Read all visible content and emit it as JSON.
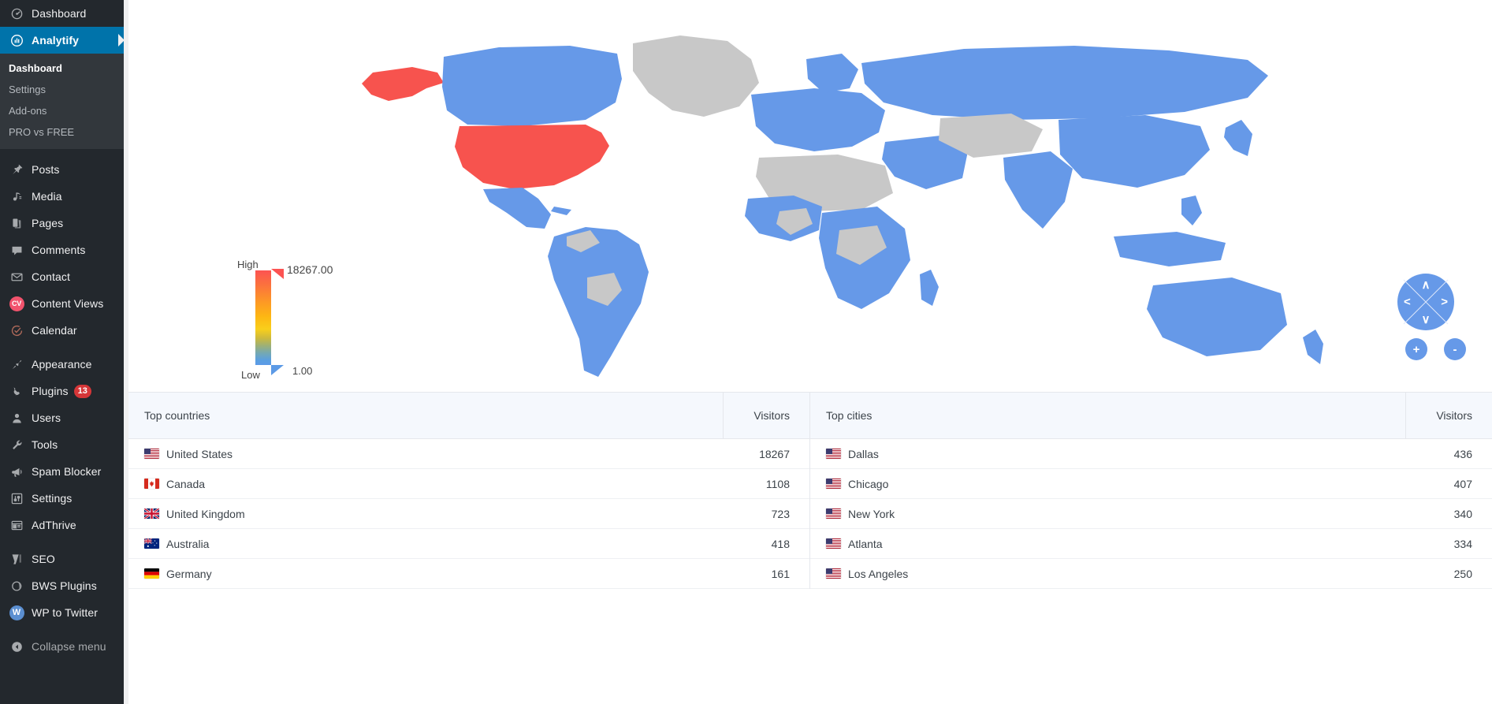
{
  "sidebar": {
    "items": [
      {
        "label": "Dashboard",
        "icon": "dashboard-icon",
        "name": "sidebar-item-dashboard"
      },
      {
        "label": "Analytify",
        "icon": "analytify-icon",
        "name": "sidebar-item-analytify",
        "active": true
      },
      {
        "label": "Posts",
        "icon": "pin-icon",
        "name": "sidebar-item-posts"
      },
      {
        "label": "Media",
        "icon": "media-icon",
        "name": "sidebar-item-media"
      },
      {
        "label": "Pages",
        "icon": "pages-icon",
        "name": "sidebar-item-pages"
      },
      {
        "label": "Comments",
        "icon": "comment-icon",
        "name": "sidebar-item-comments"
      },
      {
        "label": "Contact",
        "icon": "envelope-icon",
        "name": "sidebar-item-contact"
      },
      {
        "label": "Content Views",
        "icon": "cv-icon",
        "name": "sidebar-item-content-views"
      },
      {
        "label": "Calendar",
        "icon": "calendar-icon",
        "name": "sidebar-item-calendar"
      },
      {
        "label": "Appearance",
        "icon": "paintbrush-icon",
        "name": "sidebar-item-appearance"
      },
      {
        "label": "Plugins",
        "icon": "plug-icon",
        "name": "sidebar-item-plugins",
        "badge": "13"
      },
      {
        "label": "Users",
        "icon": "user-icon",
        "name": "sidebar-item-users"
      },
      {
        "label": "Tools",
        "icon": "wrench-icon",
        "name": "sidebar-item-tools"
      },
      {
        "label": "Spam Blocker",
        "icon": "megaphone-icon",
        "name": "sidebar-item-spam-blocker"
      },
      {
        "label": "Settings",
        "icon": "sliders-icon",
        "name": "sidebar-item-settings"
      },
      {
        "label": "AdThrive",
        "icon": "adthrive-icon",
        "name": "sidebar-item-adthrive"
      },
      {
        "label": "SEO",
        "icon": "yoast-icon",
        "name": "sidebar-item-seo"
      },
      {
        "label": "BWS Plugins",
        "icon": "bws-icon",
        "name": "sidebar-item-bws-plugins"
      },
      {
        "label": "WP to Twitter",
        "icon": "wp-twitter-icon",
        "name": "sidebar-item-wp-to-twitter"
      },
      {
        "label": "Collapse menu",
        "icon": "collapse-icon",
        "name": "sidebar-collapse-menu"
      }
    ],
    "submenu": {
      "items": [
        {
          "label": "Dashboard",
          "current": true
        },
        {
          "label": "Settings",
          "current": false
        },
        {
          "label": "Add-ons",
          "current": false
        },
        {
          "label": "PRO vs FREE",
          "current": false
        }
      ]
    }
  },
  "map": {
    "legend": {
      "high_label": "High",
      "low_label": "Low",
      "high_value": "18267.00",
      "low_value": "1.00",
      "high_color": "#fc5352",
      "low_color": "#5c9ae6"
    },
    "controls": {
      "up": "∧",
      "down": "∨",
      "left": "<",
      "right": ">",
      "zoom_in": "+",
      "zoom_out": "-"
    },
    "colors": {
      "highlight": "#f7534e",
      "data": "#5c9ae6",
      "nodata": "#c8c8c8",
      "background": "#ffffff"
    }
  },
  "chart_data": {
    "type": "table",
    "title": "Top countries and Top cities by Visitors",
    "countries": {
      "header_label": "Top countries",
      "header_value": "Visitors",
      "categories": [
        "United States",
        "Canada",
        "United Kingdom",
        "Australia",
        "Germany"
      ],
      "values": [
        18267,
        1108,
        723,
        418,
        161
      ],
      "flags": [
        "us",
        "ca",
        "gb",
        "au",
        "de"
      ]
    },
    "cities": {
      "header_label": "Top cities",
      "header_value": "Visitors",
      "categories": [
        "Dallas",
        "Chicago",
        "New York",
        "Atlanta",
        "Los Angeles"
      ],
      "values": [
        436,
        407,
        340,
        334,
        250
      ],
      "flags": [
        "us",
        "us",
        "us",
        "us",
        "us"
      ]
    }
  },
  "tables": {
    "countries": {
      "header_label": "Top countries",
      "header_value": "Visitors",
      "rows": [
        {
          "label": "United States",
          "value": "18267",
          "flag": "us"
        },
        {
          "label": "Canada",
          "value": "1108",
          "flag": "ca"
        },
        {
          "label": "United Kingdom",
          "value": "723",
          "flag": "gb"
        },
        {
          "label": "Australia",
          "value": "418",
          "flag": "au"
        },
        {
          "label": "Germany",
          "value": "161",
          "flag": "de"
        }
      ]
    },
    "cities": {
      "header_label": "Top cities",
      "header_value": "Visitors",
      "rows": [
        {
          "label": "Dallas",
          "value": "436",
          "flag": "us"
        },
        {
          "label": "Chicago",
          "value": "407",
          "flag": "us"
        },
        {
          "label": "New York",
          "value": "340",
          "flag": "us"
        },
        {
          "label": "Atlanta",
          "value": "334",
          "flag": "us"
        },
        {
          "label": "Los Angeles",
          "value": "250",
          "flag": "us"
        }
      ]
    }
  }
}
